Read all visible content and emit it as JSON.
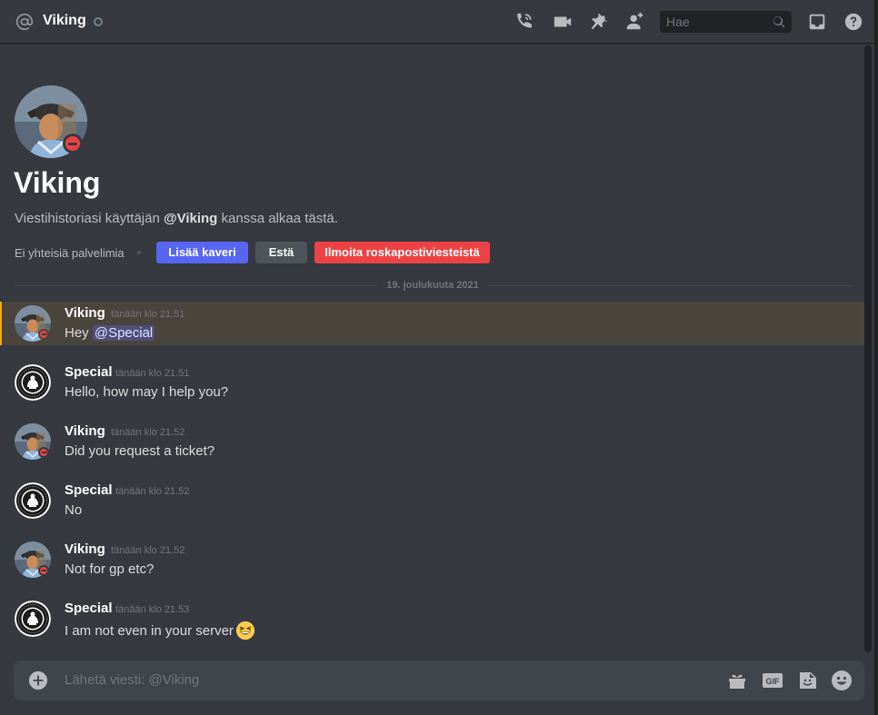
{
  "header": {
    "title": "Viking",
    "search_placeholder": "Hae",
    "icons": [
      "at-icon",
      "status-idle-icon",
      "start-voice-call-icon",
      "start-video-call-icon",
      "pinned-messages-icon",
      "add-friends-to-dm-icon",
      "search-icon",
      "inbox-icon",
      "help-icon"
    ]
  },
  "intro": {
    "name": "Viking",
    "desc_prefix": "Viestihistoriasi käyttäjän ",
    "desc_user": "@Viking",
    "desc_suffix": " kanssa alkaa tästä.",
    "mutual_servers": "Ei yhteisiä palvelimia",
    "add_friend": "Lisää kaveri",
    "block": "Estä",
    "report_spam": "Ilmoita roskapostiviesteistä"
  },
  "date_divider": "19. joulukuuta 2021",
  "messages": [
    {
      "author": "Viking",
      "timestamp": "tänään klo 21.51",
      "text": "Hey ",
      "mention": "@Special",
      "highlighted": true
    },
    {
      "author": "Special",
      "timestamp": "tänään klo 21.51",
      "text": "Hello, how may I help you?"
    },
    {
      "author": "Viking",
      "timestamp": "tänään klo 21.52",
      "text": "Did you request a ticket?"
    },
    {
      "author": "Special",
      "timestamp": "tänään klo 21.52",
      "text": "No"
    },
    {
      "author": "Viking",
      "timestamp": "tänään klo 21.52",
      "text": "Not for gp etc?"
    },
    {
      "author": "Special",
      "timestamp": "tänään klo 21.53",
      "text": "I am not even in your server",
      "emoji": "grinning-squinting-face"
    }
  ],
  "composer": {
    "placeholder": "Lähetä viesti: @Viking",
    "icons": [
      "upload-plus-icon",
      "gift-icon",
      "gif-icon",
      "sticker-icon",
      "emoji-icon"
    ]
  },
  "colors": {
    "background": "#36393f",
    "accent": "#5865f2",
    "danger": "#ed4245",
    "highlight": "#49443c",
    "highlight_bar": "#faa81a"
  }
}
